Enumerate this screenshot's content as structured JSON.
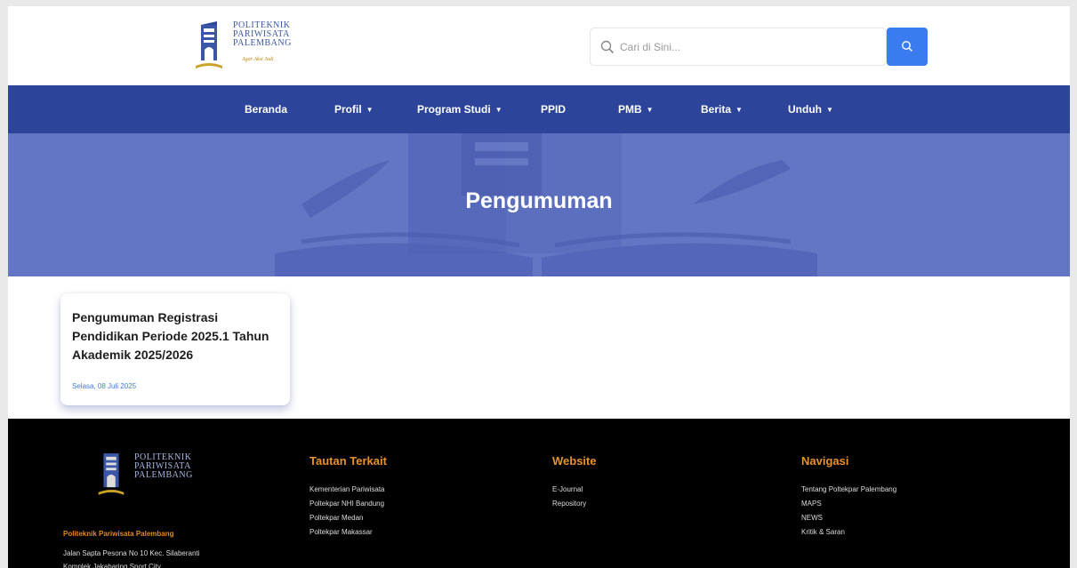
{
  "header": {
    "logo": {
      "line1": "POLITEKNIK",
      "line2": "PARIWISATA",
      "line3": "PALEMBANG",
      "tagline": "Agar Aksi Jadi"
    },
    "search": {
      "placeholder": "Cari di Sini..."
    }
  },
  "nav": {
    "items": [
      {
        "label": "Beranda",
        "dropdown": false
      },
      {
        "label": "Profil",
        "dropdown": true
      },
      {
        "label": "Program Studi",
        "dropdown": true
      },
      {
        "label": "PPID",
        "dropdown": false
      },
      {
        "label": "PMB",
        "dropdown": true
      },
      {
        "label": "Berita",
        "dropdown": true
      },
      {
        "label": "Unduh",
        "dropdown": true
      }
    ],
    "caret": "▼"
  },
  "hero": {
    "title": "Pengumuman"
  },
  "announcements": [
    {
      "title": "Pengumuman Registrasi Pendidikan Periode 2025.1 Tahun Akademik 2025/2026",
      "date": "Selasa, 08 Juli 2025"
    }
  ],
  "footer": {
    "logo": {
      "line1": "POLITEKNIK",
      "line2": "PARIWISATA",
      "line3": "PALEMBANG"
    },
    "org_name": "Politeknik Pariwisata Palembang",
    "address_line1": "Jalan Sapta Pesona No 10 Kec. Silaberanti",
    "address_line2": "Komplek Jakabaring Sport City",
    "columns": [
      {
        "heading": "Tautan Terkait",
        "links": [
          "Kementerian Pariwisata",
          "Poltekpar NHI Bandung",
          "Poltekpar Medan",
          "Poltekpar Makassar"
        ]
      },
      {
        "heading": "Website",
        "links": [
          "E-Journal",
          "Repository"
        ]
      },
      {
        "heading": "Navigasi",
        "links": [
          "Tentang Poltekpar Palembang",
          "MAPS",
          "NEWS",
          "Kritik & Saran"
        ]
      }
    ]
  },
  "colors": {
    "nav_bg": "#2c459a",
    "hero_bg": "#6376c4",
    "search_button": "#3a7bf0",
    "footer_heading": "#e8912a",
    "date_text": "#3d7ddc"
  },
  "icons": {
    "search_field": "search-icon",
    "search_button": "search-icon"
  }
}
